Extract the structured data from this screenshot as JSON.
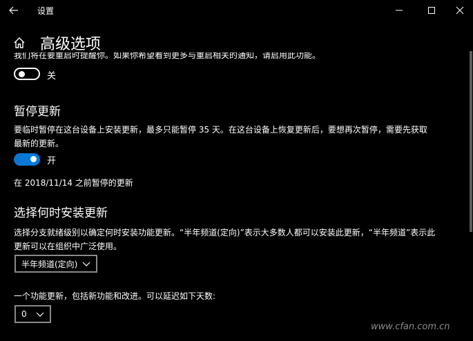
{
  "window": {
    "title": "设置",
    "controls": [
      "minimize-icon",
      "maximize-icon",
      "close-icon"
    ]
  },
  "page": {
    "title": "高级选项",
    "clipped_text": "我们将在要重启时提醒你。如果你希望看到更多与重启相关的通知，请启用此功能。"
  },
  "restart_notify": {
    "toggle_state": "off",
    "label": "关"
  },
  "pause": {
    "heading": "暂停更新",
    "description_line1": "要临时暂停在这台设备上安装更新，最多只能暂停 35 天。在这台设备上恢复更新后，要想再次暂停，需要先获取",
    "description_line2": "最新的更新。",
    "toggle_state": "on",
    "label": "开",
    "paused_until": "在 2018/11/14 之前暂停的更新"
  },
  "choose_when": {
    "heading": "选择何时安装更新",
    "description_line1": "选择分支就绪级别以确定何时安装功能更新。“半年频道(定向)”表示大多数人都可以安装此更新，“半年频道”表示此",
    "description_line2": "更新可以在组织中广泛使用。",
    "branch_selected": "半年频道(定向)",
    "feature_label": "一个功能更新，包括新功能和改进。可以延迟如下天数:",
    "defer_days_selected": "0"
  },
  "colors": {
    "background": "#000000",
    "toggle_on": "#0a78d7",
    "dropdown_border": "#8a8a8a"
  },
  "watermark": "www.cfan.com.cn"
}
